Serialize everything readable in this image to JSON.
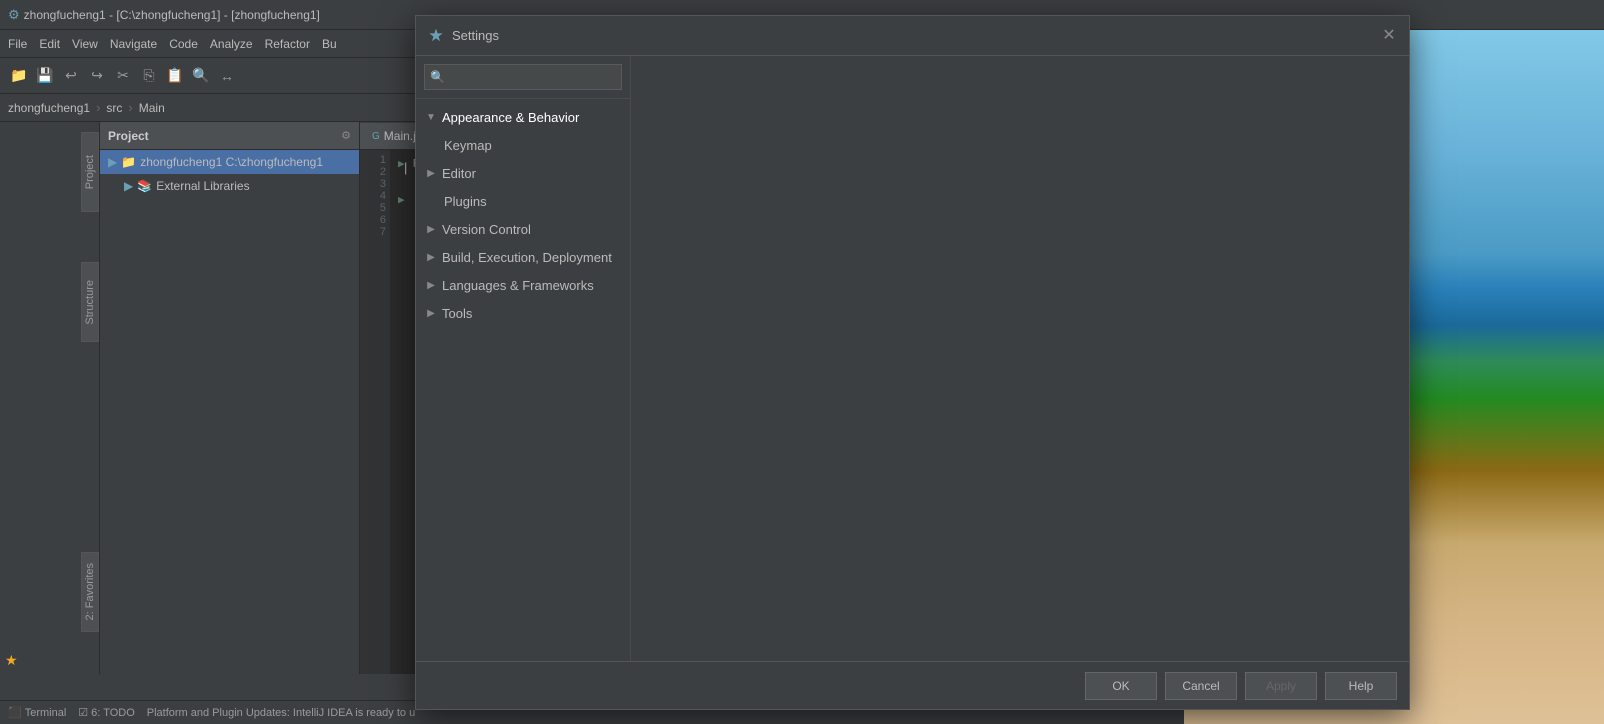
{
  "ide": {
    "title": "zhongfucheng1 - [C:\\zhongfucheng1] - [zhongfucheng1]",
    "title_icon": "intellij-icon",
    "menu_items": [
      "File",
      "Edit",
      "View",
      "Navigate",
      "Code",
      "Analyze",
      "Refactor",
      "Bu"
    ],
    "breadcrumb": [
      "zhongfucheng1",
      "src",
      "Main"
    ],
    "project_label": "Project",
    "project_items": [
      {
        "label": "zhongfucheng1  C:\\zhongfucheng1",
        "icon": "project-icon",
        "expanded": true
      },
      {
        "label": "External Libraries",
        "icon": "library-icon",
        "expanded": false
      }
    ],
    "editor_tab": "Main.ja",
    "statusbar_items": [
      "Terminal",
      "6: TODO",
      "Platform and Plugin Updates: IntelliJ IDEA is ready to u"
    ],
    "side_tabs": [
      "Project",
      "Structure",
      "2: Favorites"
    ]
  },
  "dialog": {
    "title": "Settings",
    "title_icon": "settings-icon",
    "search_placeholder": "",
    "tree_items": [
      {
        "label": "Appearance & Behavior",
        "expanded": true,
        "level": 0
      },
      {
        "label": "Keymap",
        "expanded": false,
        "level": 1
      },
      {
        "label": "Editor",
        "expanded": false,
        "level": 0
      },
      {
        "label": "Plugins",
        "expanded": false,
        "level": 1
      },
      {
        "label": "Version Control",
        "expanded": false,
        "level": 0
      },
      {
        "label": "Build, Execution, Deployment",
        "expanded": false,
        "level": 0
      },
      {
        "label": "Languages & Frameworks",
        "expanded": false,
        "level": 0
      },
      {
        "label": "Tools",
        "expanded": false,
        "level": 0
      }
    ],
    "footer": {
      "ok_label": "OK",
      "cancel_label": "Cancel",
      "apply_label": "Apply",
      "help_label": "Help"
    }
  }
}
